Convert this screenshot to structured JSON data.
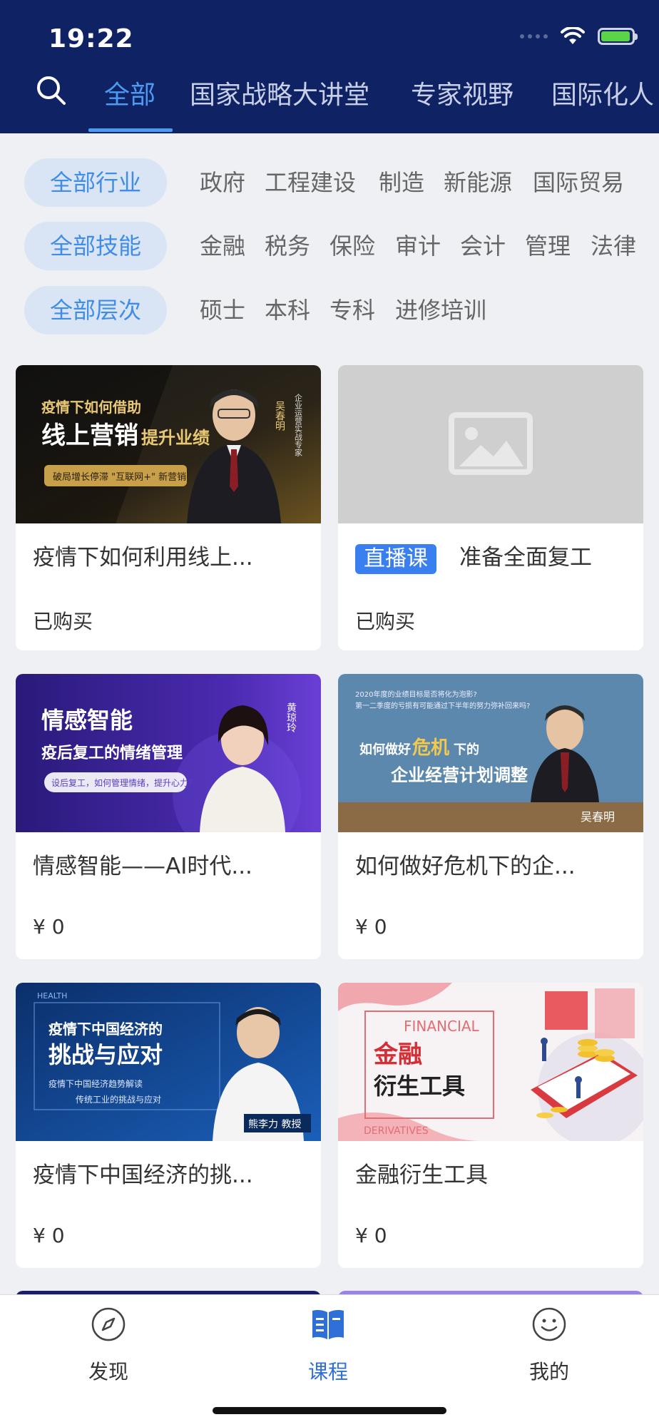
{
  "status_bar": {
    "time": "19:22"
  },
  "tabs": [
    "全部",
    "国家战略大讲堂",
    "专家视野",
    "国际化人"
  ],
  "filters": [
    {
      "label": "全部行业",
      "options": [
        "政府",
        "工程建设",
        "制造",
        "新能源",
        "国际贸易"
      ]
    },
    {
      "label": "全部技能",
      "options": [
        "金融",
        "税务",
        "保险",
        "审计",
        "会计",
        "管理",
        "法律"
      ]
    },
    {
      "label": "全部层次",
      "options": [
        "硕士",
        "本科",
        "专科",
        "进修培训"
      ]
    }
  ],
  "courses": [
    {
      "title": "疫情下如何利用线上...",
      "meta": "已购买",
      "thumb": {
        "line1": "疫情下如何借助",
        "line2a": "线上营销",
        "line2b": "提升业绩",
        "line3": "破局增长停滞 \"互联网+\" 新营销",
        "side": "企业运营实战专家",
        "name": "吴春明"
      }
    },
    {
      "badge": "直播课",
      "title": "准备全面复工",
      "meta": "已购买"
    },
    {
      "title": "情感智能——AI时代...",
      "meta": "¥ 0",
      "thumb": {
        "line1": "情感智能",
        "line2": "疫后复工的情绪管理",
        "line3": "设后复工，如何管理情绪，提升心力?",
        "name": "黄琼玲"
      }
    },
    {
      "title": "如何做好危机下的企...",
      "meta": "¥ 0",
      "thumb": {
        "top1": "2020年度的业绩目标是否将化为泡影?",
        "top2": "第一二季度的亏损有可能通过下半年的努力弥补回来吗?",
        "line1a": "如何做好",
        "line1b": "危机",
        "line1c": "下的",
        "line2": "企业经营计划调整",
        "name": "吴春明"
      }
    },
    {
      "title": "疫情下中国经济的挑...",
      "meta": "¥ 0",
      "thumb": {
        "tag": "HEALTH",
        "line1": "疫情下中国经济的",
        "line2": "挑战与应对",
        "line3": "疫情下中国经济趋势解读",
        "line4": "传统工业的挑战与应对",
        "name": "熊李力 教授"
      }
    },
    {
      "title": "金融衍生工具",
      "meta": "¥ 0",
      "thumb": {
        "en1": "FINANCIAL",
        "zh1": "金融",
        "zh2": "衍生工具",
        "en2": "DERIVATIVES"
      }
    }
  ],
  "bottom_nav": [
    "发现",
    "课程",
    "我的"
  ],
  "colors": {
    "header": "#0f2263",
    "accent": "#4c9bf2",
    "pill_bg": "#d9e4f4"
  }
}
